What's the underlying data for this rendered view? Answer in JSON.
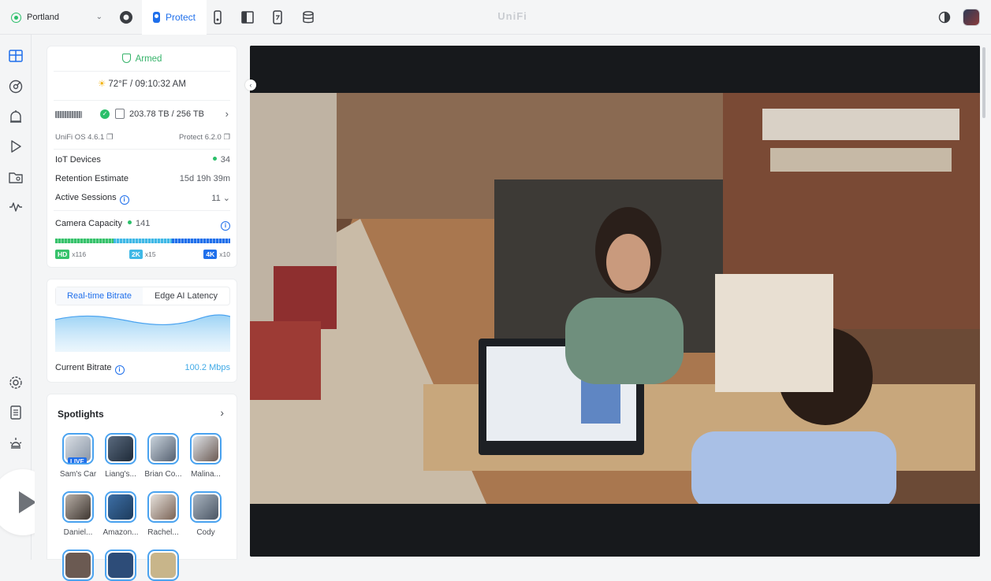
{
  "topbar": {
    "site": "Portland",
    "active_app": "Protect",
    "brand": "UniFi"
  },
  "status": {
    "armed": "Armed",
    "weather": "72°F / 09:10:32 AM",
    "storage": "203.78 TB / 256 TB",
    "os_version": "UniFi OS 4.6.1",
    "protect_version": "Protect 6.2.0"
  },
  "stats": {
    "iot_label": "IoT Devices",
    "iot_value": "34",
    "retention_label": "Retention Estimate",
    "retention_value": "15d 19h 39m",
    "sessions_label": "Active Sessions",
    "sessions_value": "11",
    "capacity_label": "Camera Capacity",
    "capacity_value": "141"
  },
  "capacity": {
    "hd_label": "HD",
    "hd_count": "x116",
    "k2_label": "2K",
    "k2_count": "x15",
    "k4_label": "4K",
    "k4_count": "x10",
    "colors": {
      "hd": "#37c26b",
      "k2": "#3fb8e6",
      "k4": "#1f6feb"
    }
  },
  "bitrate": {
    "tabs": [
      "Real-time Bitrate",
      "Edge AI Latency"
    ],
    "current_label": "Current Bitrate",
    "current_value": "100.2 Mbps"
  },
  "spotlights": {
    "title": "Spotlights",
    "live_label": "LIVE",
    "items": [
      "Sam's Car",
      "Liang's...",
      "Brian Co...",
      "Malina...",
      "Daniel...",
      "Amazon...",
      "Rachel...",
      "Cody"
    ]
  },
  "icons": {
    "topbar": [
      "circle-record-icon",
      "doorbell-icon",
      "panel-icon",
      "sensor-icon",
      "database-icon",
      "theme-toggle-icon"
    ],
    "rail": [
      "dashboard-icon",
      "detections-icon",
      "alarm-icon",
      "play-icon",
      "folder-icon",
      "activity-icon",
      "settings-icon",
      "logs-icon",
      "light-icon"
    ]
  }
}
